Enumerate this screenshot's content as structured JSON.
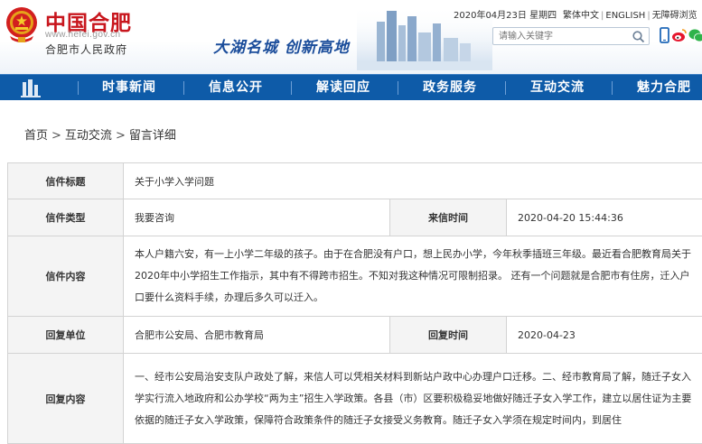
{
  "header": {
    "logo_title": "中国合肥",
    "logo_url": "www.hefei.gov.cn",
    "logo_subtitle": "合肥市人民政府",
    "slogan": "大湖名城  创新高地",
    "date_text": "2020年04月23日 星期四",
    "top_links": [
      "繁体中文",
      "ENGLISH",
      "无障碍浏览"
    ],
    "search_placeholder": "请输入关键字"
  },
  "nav": {
    "items": [
      "时事新闻",
      "信息公开",
      "解读回应",
      "政务服务",
      "互动交流",
      "魅力合肥"
    ]
  },
  "breadcrumb": {
    "items": [
      "首页",
      "互动交流",
      "留言详细"
    ],
    "separator": ">"
  },
  "detail": {
    "title_label": "信件标题",
    "title_value": "关于小学入学问题",
    "type_label": "信件类型",
    "type_value": "我要咨询",
    "received_label": "来信时间",
    "received_value": "2020-04-20 15:44:36",
    "content_label": "信件内容",
    "content_value": "本人户籍六安，有一上小学二年级的孩子。由于在合肥没有户口，想上民办小学，今年秋季插班三年级。最近看合肥教育局关于2020年中小学招生工作指示，其中有不得跨市招生。不知对我这种情况可限制招录。 还有一个问题就是合肥市有住房，迁入户口要什么资料手续，办理后多久可以迁入。",
    "reply_unit_label": "回复单位",
    "reply_unit_value": "合肥市公安局、合肥市教育局",
    "reply_time_label": "回复时间",
    "reply_time_value": "2020-04-23",
    "reply_content_label": "回复内容",
    "reply_content_value": "一、经市公安局治安支队户政处了解，来信人可以凭相关材料到新站户政中心办理户口迁移。二、经市教育局了解，随迁子女入学实行流入地政府和公办学校“两为主”招生入学政策。各县（市）区要积极稳妥地做好随迁子女入学工作，建立以居住证为主要依据的随迁子女入学政策，保障符合政策条件的随迁子女接受义务教育。随迁子女入学须在规定时间内，到居住"
  },
  "colors": {
    "nav_blue": "#0e5ba8",
    "brand_red": "#c8161d",
    "label_blue": "#1f5597"
  }
}
